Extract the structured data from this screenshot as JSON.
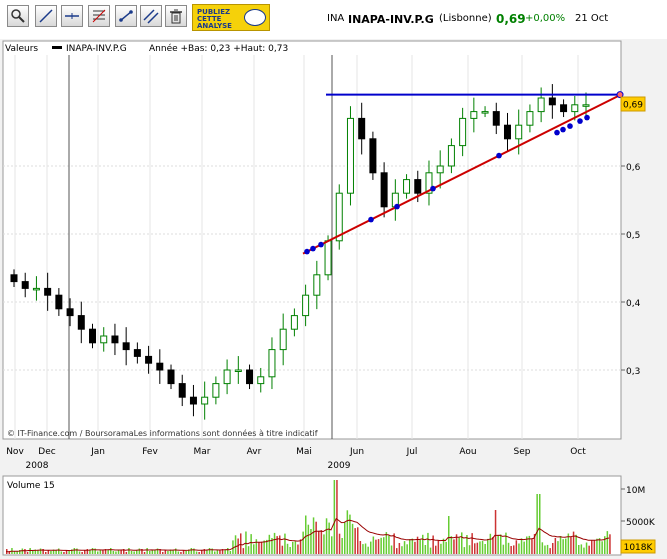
{
  "header": {
    "market_code": "INA",
    "stock_name": "INAPA-INV.P.G",
    "exchange": "(Lisbonne)",
    "price": "0,69",
    "change": "+0,00%",
    "date": "21 Oct"
  },
  "toolbar": {
    "buttons": [
      "zoom-tool",
      "line-tool",
      "horizontal-line-tool",
      "fibonacci-tool",
      "point-tool",
      "parallel-line-tool",
      "delete-tool"
    ],
    "publish_line1": "PUBLIEZ",
    "publish_line2": "CETTE",
    "publish_line3": "ANALYSE"
  },
  "legend": {
    "valeurs": "Valeurs",
    "series": "INAPA-INV.P.G",
    "range": "Année +Bas: 0,23 +Haut: 0,73"
  },
  "price_badge": "0,69",
  "credit": "© IT-Finance.com / BoursoramaLes informations sont données à titre indicatif",
  "volume_title": "Volume 15",
  "volume_badge": "1018K",
  "colors": {
    "up_candle": "#008000",
    "down_candle": "#000000",
    "resistance": "#0000cc",
    "support": "#cc0000",
    "touch_point": "#0000cc",
    "volume_up": "#66cc33",
    "volume_down": "#cc3333",
    "volume_ma": "#990000",
    "price_badge_bg": "#ffcc00",
    "change_text": "#008000"
  },
  "chart_data": {
    "type": "candlestick",
    "period": "weekly",
    "x_months": [
      "Nov",
      "Dec",
      "Jan",
      "Fev",
      "Mar",
      "Avr",
      "Mai",
      "Jun",
      "Jul",
      "Aou",
      "Sep",
      "Oct"
    ],
    "x_years": [
      "2008",
      "2009"
    ],
    "y_ticks": [
      "0,3",
      "0,4",
      "0,5",
      "0,6"
    ],
    "ylim": [
      0.23,
      0.73
    ],
    "close": [
      0.43,
      0.42,
      0.42,
      0.41,
      0.39,
      0.38,
      0.36,
      0.34,
      0.35,
      0.34,
      0.33,
      0.32,
      0.31,
      0.3,
      0.28,
      0.26,
      0.25,
      0.26,
      0.28,
      0.3,
      0.3,
      0.28,
      0.29,
      0.33,
      0.36,
      0.38,
      0.41,
      0.44,
      0.49,
      0.56,
      0.67,
      0.64,
      0.59,
      0.54,
      0.56,
      0.58,
      0.56,
      0.59,
      0.6,
      0.63,
      0.67,
      0.68,
      0.68,
      0.66,
      0.64,
      0.66,
      0.68,
      0.7,
      0.69,
      0.68,
      0.69,
      0.69
    ],
    "annotations": {
      "resistance_level": 0.705,
      "support_trendline": [
        [
          0.47,
          0.48
        ],
        [
          0.705,
          0.705
        ]
      ],
      "current_price": "0,69"
    },
    "volume_ticks": [
      "10M",
      "5000K"
    ],
    "volume": {
      "last": "1018K",
      "moving_average": true
    },
    "grid": true,
    "legend_position": "top-left"
  }
}
